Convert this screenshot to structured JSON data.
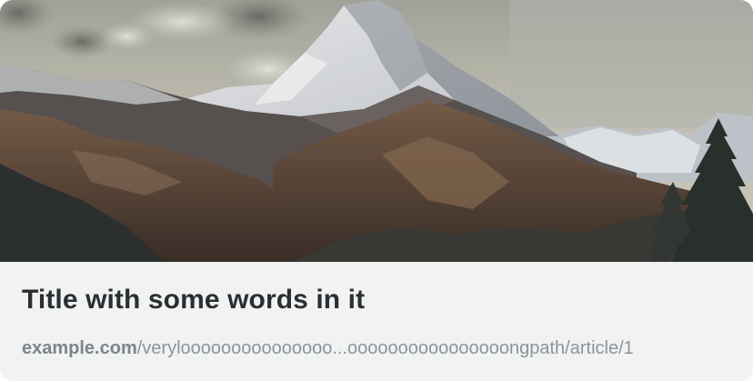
{
  "card": {
    "title": "Title with some words in it",
    "domain": "example.com",
    "path": "/verylooooooooooooooo...oooooooooooooooongpath/article/1"
  }
}
